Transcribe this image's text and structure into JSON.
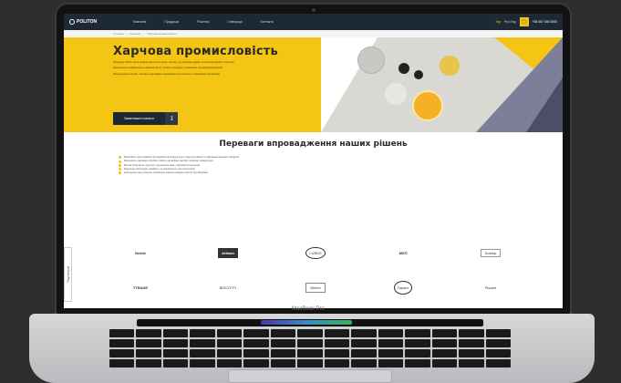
{
  "nav": {
    "brand": "POLITON",
    "links": [
      "Компанія",
      "Продукція",
      "Рішення",
      "Співпраця",
      "Контакти"
    ],
    "lang_active": "Укр",
    "lang_other": "Рус Eng",
    "cart_icon": "cart-icon",
    "phone": "+38 067 000 0000"
  },
  "breadcrumb": [
    "Головна",
    "Рішення",
    "Харчова промисловість"
  ],
  "hero": {
    "title": "Харчова промисловість",
    "paragraphs": [
      "Продукція Politon часто використовується в різних галузях, де необхідні надійні та безпечні вироби з пластику.",
      "Наші рішення забезпечують надійний захист та якість продукції, оптимізацію процесів виробництва.",
      "Рекомендуємо вироби, які мають сертифікат відповідності для контакту з харчовими продуктами."
    ],
    "button_label": "Завантажити каталог",
    "download_icon": "download-icon"
  },
  "advantages": {
    "title": "Переваги впровадження наших рішень",
    "items": [
      "Можливість застосування при виробництві продуктів для транспортування та зберігання харчових продуктів",
      "Можливість санітарної обробки, стійкість до мийних засобів та високої температури",
      "Висока гігієнічність і зручність при використанні у виробничих процесах",
      "Модульна конструкція, надійність та довговічність при експлуатації",
      "Конструкція тари дозволяє оптимально використовувати простір при зберіганні"
    ]
  },
  "partners": {
    "side_tab": "Партнери",
    "logos": [
      "Nestle",
      "Artisan",
      "LUBUS",
      "МХП",
      "Dostup",
      "TTRADE",
      "BISCOTTI",
      "Wimm",
      "Гарант",
      "Рошен"
    ]
  },
  "device": {
    "model": "MacBook Pro"
  }
}
